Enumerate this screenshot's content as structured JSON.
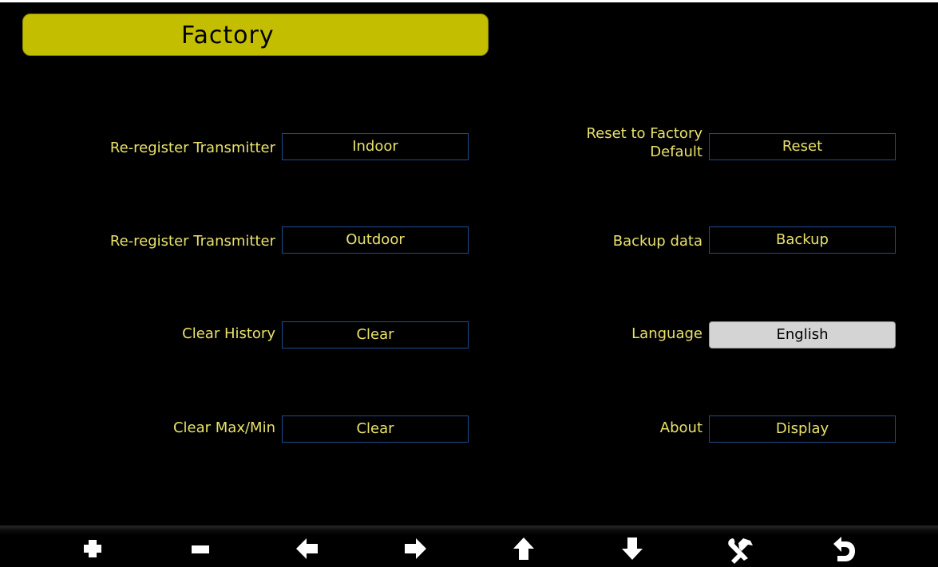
{
  "header": {
    "title": "Factory"
  },
  "left_settings": [
    {
      "label": "Re-register Transmitter",
      "button": "Indoor"
    },
    {
      "label": "Re-register Transmitter",
      "button": "Outdoor"
    },
    {
      "label": "Clear History",
      "button": "Clear"
    },
    {
      "label": "Clear Max/Min",
      "button": "Clear"
    }
  ],
  "right_settings": [
    {
      "label_line1": "Reset to Factory",
      "label_line2": "Default",
      "button": "Reset"
    },
    {
      "label": "Backup data",
      "button": "Backup"
    },
    {
      "label": "Language",
      "button": "English",
      "selected": true
    },
    {
      "label": "About",
      "button": "Display"
    }
  ],
  "toolbar": {
    "buttons": [
      "plus-icon",
      "minus-icon",
      "arrow-left-icon",
      "arrow-right-icon",
      "arrow-up-icon",
      "arrow-down-icon",
      "tools-icon",
      "return-icon"
    ]
  },
  "colors": {
    "background": "#000000",
    "title_bar": "#c4be00",
    "label_text": "#e8e26a",
    "button_border": "#1e4d8f",
    "selected_button": "#d4d4d4",
    "icon": "#ffffff"
  }
}
